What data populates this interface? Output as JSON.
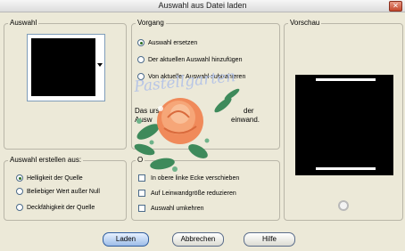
{
  "window": {
    "title": "Auswahl aus Datei laden",
    "close_glyph": "✕"
  },
  "auswahl": {
    "legend": "Auswahl"
  },
  "erstellen": {
    "legend": "Auswahl erstellen aus:",
    "options": [
      "Helligkeit der Quelle",
      "Beliebiger Wert außer Null",
      "Deckfähigkeit der Quelle"
    ],
    "selected_index": 0
  },
  "vorgang": {
    "legend": "Vorgang",
    "options": [
      "Auswahl ersetzen",
      "Der aktuellen Auswahl hinzufügen",
      "Von aktueller Auswahl subtrahieren"
    ],
    "selected_index": 0,
    "desc_line1": "Das urs",
    "desc_line1_tail": "der",
    "desc_line2": "Ausw",
    "desc_line2_tail": "einwand."
  },
  "optionen": {
    "legend": "O",
    "checks": [
      "In obere linke Ecke verschieben",
      "Auf Leinwandgröße reduzieren",
      "Auswahl umkehren"
    ]
  },
  "vorschau": {
    "legend": "Vorschau"
  },
  "buttons": {
    "load": "Laden",
    "cancel": "Abbrechen",
    "help": "Hilfe"
  },
  "overlay": {
    "watermark": "Pastellgarten"
  },
  "colors": {
    "background": "#ece9d8",
    "border": "#b9b6a8",
    "rose": "#f08a5a",
    "leaf": "#3e8a5b"
  }
}
